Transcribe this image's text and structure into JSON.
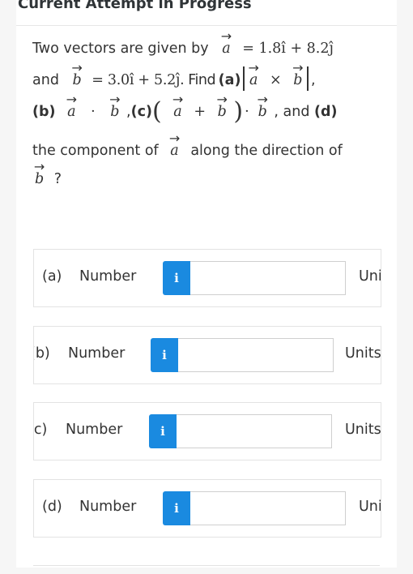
{
  "header": {
    "title": "Current Attempt in Progress"
  },
  "question": {
    "intro": "Two vectors are given by",
    "vec_a": "a",
    "vec_b": "b",
    "a_expr": "= 1.8î + 8.2ĵ",
    "and": "and",
    "b_expr": "= 3.0î + 5.2ĵ",
    "find": ". Find",
    "part_a": "(a)",
    "cross": "×",
    "comma": ",",
    "part_b": "(b)",
    "dot": "·",
    "comma_sp": " ,",
    "part_c": "(c)",
    "lparen": "(",
    "plus": "+",
    "rparen": ")",
    "and_d": " , and ",
    "part_d": "(d)",
    "line4": "the component of",
    "line4b": "along the direction of",
    "qmark": "?"
  },
  "answers": [
    {
      "label": "(a)",
      "type_label": "Number",
      "value": "",
      "units_label": "Units",
      "info_icon": "i"
    },
    {
      "label": "(b)",
      "type_label": "Number",
      "value": "",
      "units_label": "Units",
      "info_icon": "i"
    },
    {
      "label": "(c)",
      "type_label": "Number",
      "value": "",
      "units_label": "Units",
      "info_icon": "i"
    },
    {
      "label": "(d)",
      "type_label": "Number",
      "value": "",
      "units_label": "Units",
      "info_icon": "i"
    }
  ],
  "colors": {
    "info_button": "#1a8ae0",
    "background": "#f6f6f6",
    "panel": "#ffffff"
  }
}
